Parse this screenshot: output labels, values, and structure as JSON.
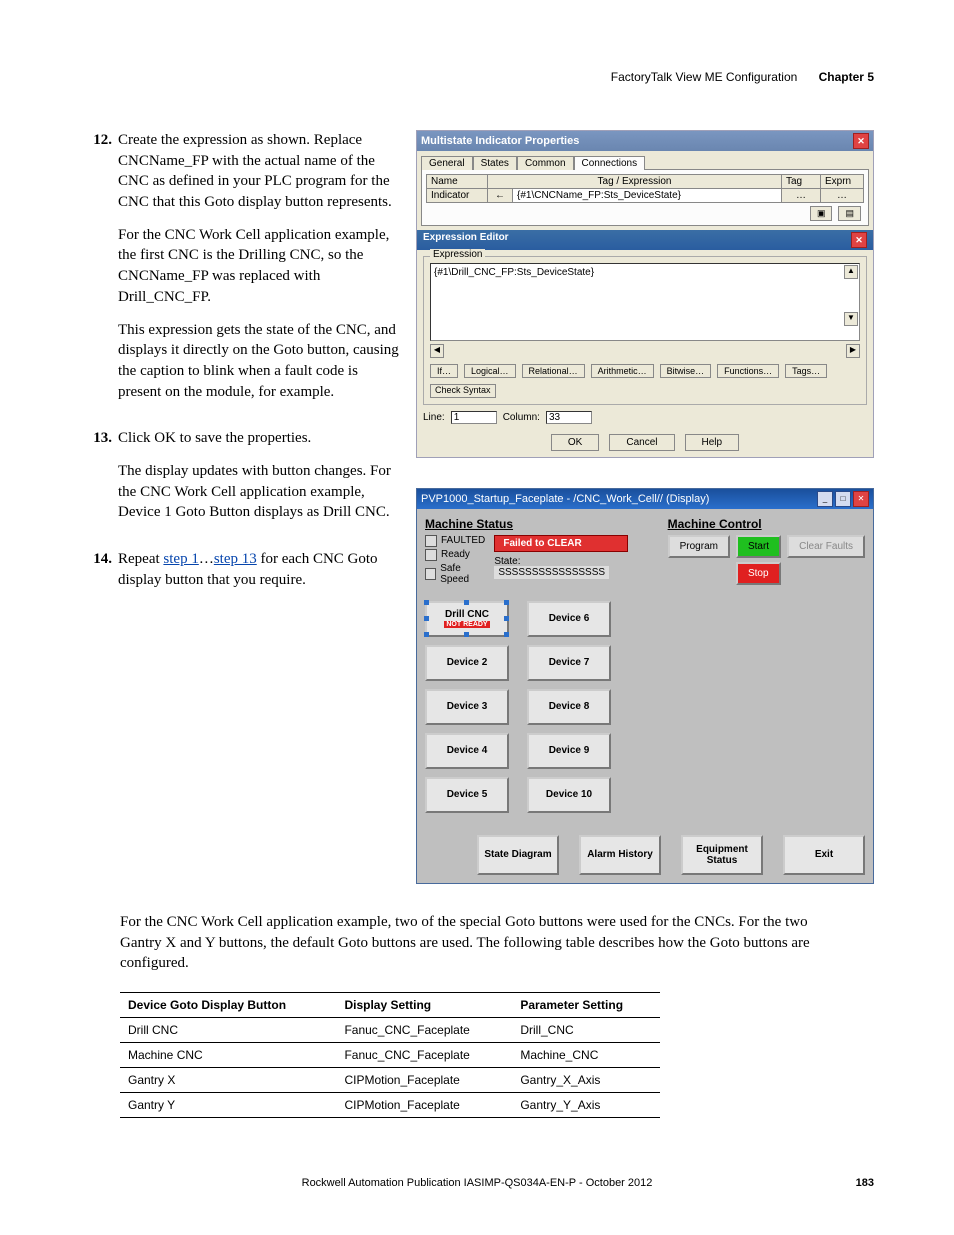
{
  "header": {
    "section": "FactoryTalk View ME Configuration",
    "chapter": "Chapter 5"
  },
  "steps": [
    {
      "num": "12.",
      "paras": [
        "Create the expression as shown. Replace CNCName_FP with the actual name of the CNC as defined in your PLC program for the CNC that this Goto display button represents.",
        "For the CNC Work Cell application example, the first CNC is the Drilling CNC, so the CNCName_FP was replaced with Drill_CNC_FP.",
        "This expression gets the state of the CNC, and displays it directly on the Goto button, causing the caption to blink when a fault code is present on the module, for example."
      ]
    },
    {
      "num": "13.",
      "paras": [
        "Click OK to save the properties.",
        "The display updates with button changes. For the CNC Work Cell application example, Device 1 Goto Button displays as Drill CNC."
      ]
    },
    {
      "num": "14.",
      "paras": [
        "Repeat <a class=\"link\" data-name=\"link-step1\" data-interactable=\"true\">step 1</a>…<a class=\"link\" data-name=\"link-step13\" data-interactable=\"true\">step 13</a> for each CNC Goto display button that you require."
      ]
    }
  ],
  "dlg1": {
    "title": "Multistate Indicator Properties",
    "tabs": [
      "General",
      "States",
      "Common",
      "Connections"
    ],
    "active_tab": 3,
    "grid_head": {
      "name": "Name",
      "tagexpr": "Tag / Expression",
      "tag": "Tag",
      "exprn": "Exprn"
    },
    "grid_row": {
      "name": "Indicator",
      "arrow": "←",
      "expr": "{#1\\CNCName_FP:Sts_DeviceState}",
      "tag": "…",
      "exprn": "…"
    },
    "editor": {
      "title": "Expression Editor",
      "group": "Expression",
      "text": "{#1\\Drill_CNC_FP:Sts_DeviceState}",
      "btns": [
        "If…",
        "Logical…",
        "Relational…",
        "Arithmetic…",
        "Bitwise…",
        "Functions…",
        "Tags…"
      ],
      "check": "Check Syntax",
      "line_lbl": "Line:",
      "line_val": "1",
      "col_lbl": "Column:",
      "col_val": "33",
      "dlgbtns": [
        "OK",
        "Cancel",
        "Help"
      ]
    }
  },
  "dlg2": {
    "title": "PVP1000_Startup_Faceplate - /CNC_Work_Cell// (Display)",
    "status_hdr": "Machine Status",
    "control_hdr": "Machine Control",
    "leds": [
      "FAULTED",
      "Ready",
      "Safe Speed"
    ],
    "fail": "Failed to CLEAR",
    "state_lbl": "State:",
    "state_val": "SSSSSSSSSSSSSSSS",
    "ctrl": {
      "program": "Program",
      "start": "Start",
      "stop": "Stop",
      "clear": "Clear Faults"
    },
    "dev_left": [
      "Drill CNC",
      "Device 2",
      "Device 3",
      "Device 4",
      "Device 5"
    ],
    "dev_left_sub": "NOT READY",
    "dev_right": [
      "Device 6",
      "Device 7",
      "Device 8",
      "Device 9",
      "Device 10"
    ],
    "bottom": [
      "State Diagram",
      "Alarm History",
      "Equipment Status",
      "Exit"
    ]
  },
  "para": "For the CNC Work Cell application example, two of the special Goto buttons were used for the CNCs. For the two Gantry X and Y buttons, the default Goto buttons are used. The following table describes how the Goto buttons are configured.",
  "table": {
    "head": [
      "Device Goto Display Button",
      "Display Setting",
      "Parameter Setting"
    ],
    "rows": [
      [
        "Drill CNC",
        "Fanuc_CNC_Faceplate",
        "Drill_CNC"
      ],
      [
        "Machine CNC",
        "Fanuc_CNC_Faceplate",
        "Machine_CNC"
      ],
      [
        "Gantry X",
        "CIPMotion_Faceplate",
        "Gantry_X_Axis"
      ],
      [
        "Gantry Y",
        "CIPMotion_Faceplate",
        "Gantry_Y_Axis"
      ]
    ]
  },
  "footer": {
    "pub": "Rockwell Automation Publication IASIMP-QS034A-EN-P - ",
    "date": "October 2012",
    "page": "183"
  }
}
